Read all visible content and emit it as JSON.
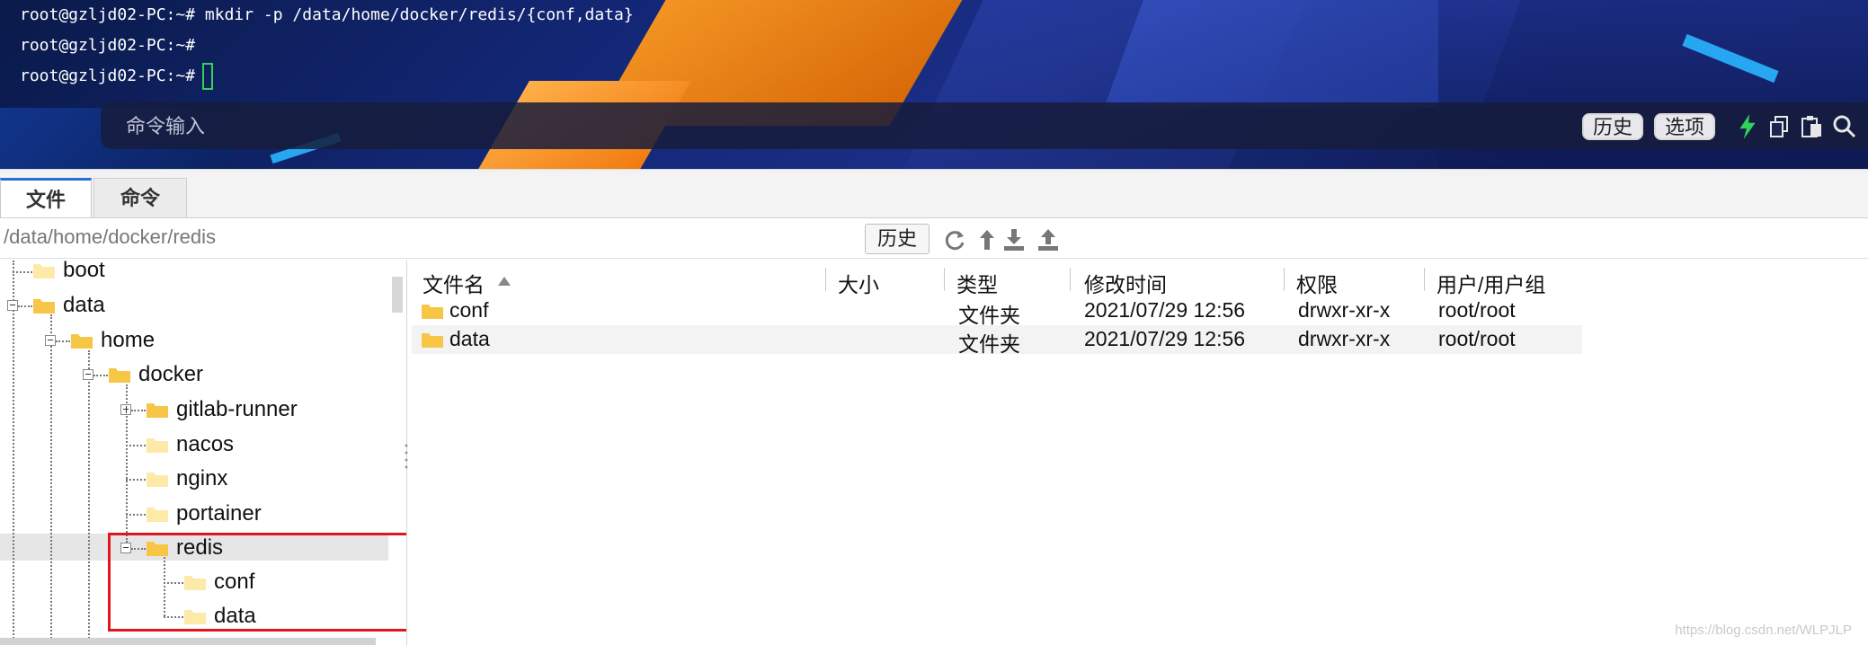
{
  "terminal": {
    "lines": [
      "root@gzljd02-PC:~# mkdir -p /data/home/docker/redis/{conf,data}",
      "root@gzljd02-PC:~#",
      "root@gzljd02-PC:~#"
    ],
    "command_placeholder": "命令输入",
    "history_label": "历史",
    "options_label": "选项",
    "accent_color": "#2fd35a"
  },
  "tabs": [
    {
      "label": "文件",
      "active": true
    },
    {
      "label": "命令",
      "active": false
    }
  ],
  "pathbar": {
    "path": "/data/home/docker/redis",
    "history_label": "历史"
  },
  "tree": {
    "items": [
      {
        "label": "boot"
      },
      {
        "label": "data"
      },
      {
        "label": "home"
      },
      {
        "label": "docker"
      },
      {
        "label": "gitlab-runner"
      },
      {
        "label": "nacos"
      },
      {
        "label": "nginx"
      },
      {
        "label": "portainer"
      },
      {
        "label": "redis"
      },
      {
        "label": "conf"
      },
      {
        "label": "data"
      }
    ],
    "highlight_color": "#e3141c"
  },
  "filelist": {
    "columns": [
      "文件名",
      "大小",
      "类型",
      "修改时间",
      "权限",
      "用户/用户组"
    ],
    "rows": [
      {
        "name": "conf",
        "size": "",
        "type": "文件夹",
        "mtime": "2021/07/29 12:56",
        "perm": "drwxr-xr-x",
        "owner": "root/root"
      },
      {
        "name": "data",
        "size": "",
        "type": "文件夹",
        "mtime": "2021/07/29 12:56",
        "perm": "drwxr-xr-x",
        "owner": "root/root"
      }
    ]
  },
  "watermark": "https://blog.csdn.net/WLPJLP"
}
